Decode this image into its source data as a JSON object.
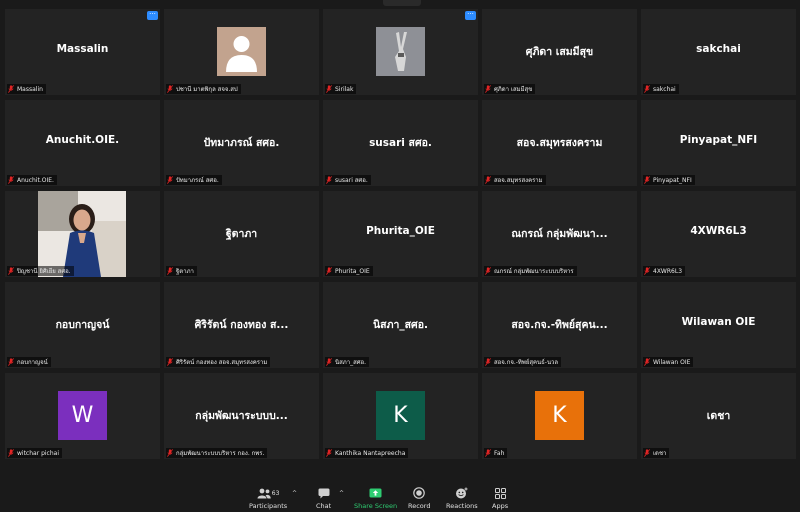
{
  "tiles": [
    {
      "type": "text",
      "title": "Massalin",
      "label": "Massalin",
      "more": true
    },
    {
      "type": "person",
      "label": "ปชานี มาตพิกุล สจจ.สป",
      "more": false
    },
    {
      "type": "image",
      "label": "Sirilak",
      "more": true
    },
    {
      "type": "text",
      "title": "ศุภิดา เสมมีสุข",
      "label": "ศุภิดา เสมมีสุข"
    },
    {
      "type": "text",
      "title": "sakchai",
      "label": "sakchai"
    },
    {
      "type": "text",
      "title": "Anuchit.OIE.",
      "label": "Anuchit.OIE."
    },
    {
      "type": "text",
      "title": "ปัทมาภรณ์ สศอ.",
      "label": "ปัทมาภรณ์ สศอ."
    },
    {
      "type": "text",
      "title": "susari สศอ.",
      "label": "susari สศอ."
    },
    {
      "type": "text",
      "title": "สอจ.สมุทรสงคราม",
      "label": "สอจ.สมุทรสงคราม"
    },
    {
      "type": "text",
      "title": "Pinyapat_NFI",
      "label": "Pinyapat_NFI"
    },
    {
      "type": "video",
      "label": "ปิญชานี ยิศิเยีย สศอ."
    },
    {
      "type": "text",
      "title": "ฐิตาภา",
      "label": "ฐิตาภา"
    },
    {
      "type": "text",
      "title": "Phurita_OIE",
      "label": "Phurita_OIE"
    },
    {
      "type": "text",
      "title": "ณกรณ์ กลุ่มพัฒนา...",
      "label": "ณกรณ์ กลุ่มพัฒนาระบบบริหาร"
    },
    {
      "type": "text",
      "title": "4XWR6L3",
      "label": "4XWR6L3"
    },
    {
      "type": "text",
      "title": "กอบกาญจน์",
      "label": "กอบกาญจน์"
    },
    {
      "type": "text",
      "title": "ศิริรัตน์ กองทอง ส...",
      "label": "ศิริรัตน์ กองทอง สอจ.สมุทรสงคราม"
    },
    {
      "type": "text",
      "title": "นิสภา_สศอ.",
      "label": "นิสภา_สศอ."
    },
    {
      "type": "text",
      "title": "สอจ.กจ.-ทิพย์สุคน...",
      "label": "สอจ.กจ.-ทิพย์สุคนธ์-นวล"
    },
    {
      "type": "text",
      "title": "Wilawan OIE",
      "label": "Wilawan OIE"
    },
    {
      "type": "letter",
      "letter": "W",
      "color": "#7b2fbe",
      "label": "witchar pichai"
    },
    {
      "type": "text",
      "title": "กลุ่มพัฒนาระบบบ...",
      "label": "กลุ่มพัฒนาระบบบริหาร กอง. กพร."
    },
    {
      "type": "letter",
      "letter": "K",
      "color": "#0d5c49",
      "label": "Kanthika Nantapreecha"
    },
    {
      "type": "letter",
      "letter": "K",
      "color": "#e8710a",
      "label": "Fah"
    },
    {
      "type": "text",
      "title": "เดชา",
      "label": "เดชา"
    }
  ],
  "toolbar": {
    "participants_label": "Participants",
    "participants_count": "63",
    "chat_label": "Chat",
    "share_label": "Share Screen",
    "record_label": "Record",
    "reactions_label": "Reactions",
    "apps_label": "Apps",
    "caret": "^",
    "more_glyph": "···"
  },
  "colors": {
    "tile_bg": "#232323",
    "accent": "#2d8cff",
    "share_green": "#2ecc71",
    "mute_red": "#e02424"
  }
}
